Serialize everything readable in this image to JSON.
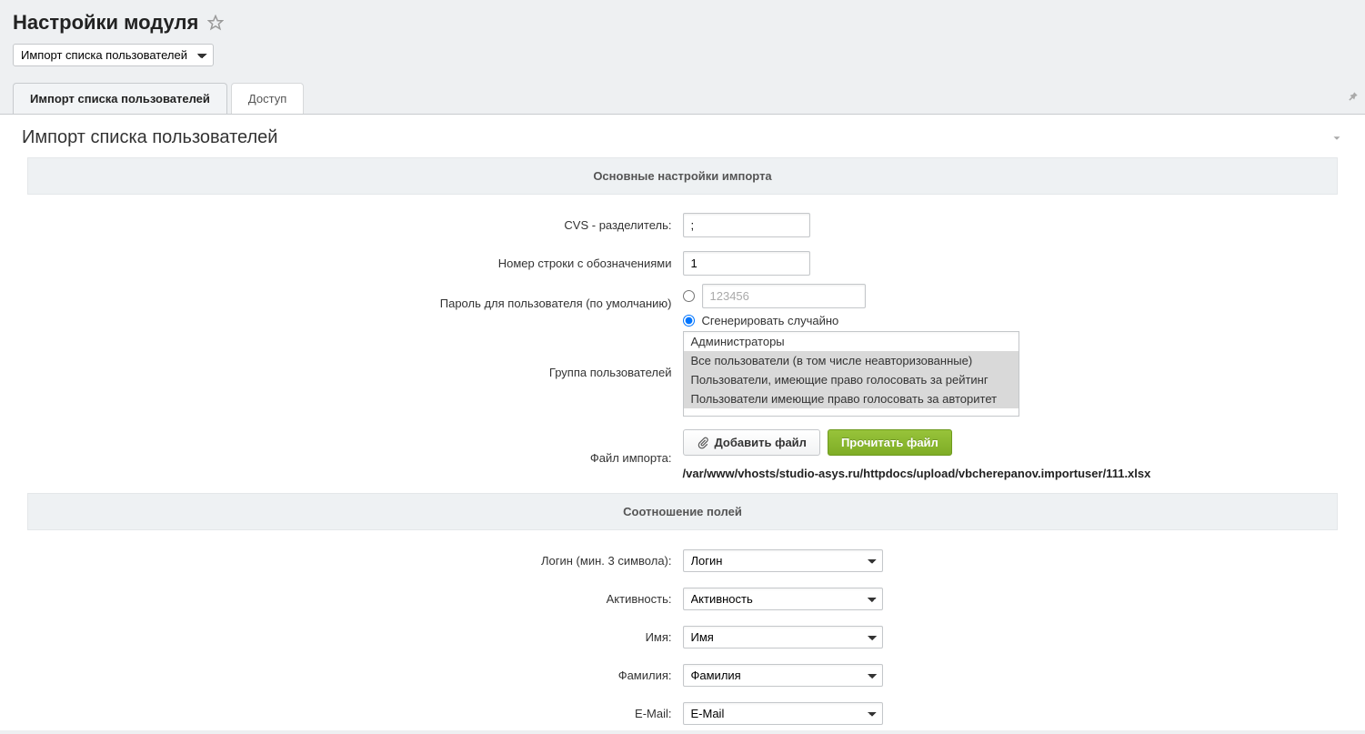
{
  "header": {
    "title": "Настройки модуля",
    "select_value": "Импорт списка пользователей"
  },
  "tabs": [
    {
      "label": "Импорт списка пользователей",
      "active": true
    },
    {
      "label": "Доступ",
      "active": false
    }
  ],
  "panel": {
    "title": "Импорт списка пользователей"
  },
  "sections": {
    "main": "Основные настройки импорта",
    "mapping": "Соотношение полей"
  },
  "form": {
    "cvs_label": "CVS - разделитель:",
    "cvs_value": ";",
    "row_label": "Номер строки с обозначениями",
    "row_value": "1",
    "pwd_label": "Пароль для пользователя (по умолчанию)",
    "pwd_placeholder": "123456",
    "pwd_radio_generate": "Сгенерировать случайно",
    "group_label": "Группа пользователей",
    "group_options": [
      {
        "text": "Администраторы",
        "selected": false
      },
      {
        "text": "Все пользователи (в том числе неавторизованные)",
        "selected": true
      },
      {
        "text": "Пользователи, имеющие право голосовать за рейтинг",
        "selected": true
      },
      {
        "text": "Пользователи имеющие право голосовать за авторитет",
        "selected": true
      }
    ],
    "file_label": "Файл импорта:",
    "add_file_btn": "Добавить файл",
    "read_file_btn": "Прочитать файл",
    "file_path": "/var/www/vhosts/studio-asys.ru/httpdocs/upload/vbcherepanov.importuser/111.xlsx"
  },
  "mapping": {
    "login_label": "Логин (мин. 3 символа):",
    "login_value": "Логин",
    "active_label": "Активность:",
    "active_value": "Активность",
    "name_label": "Имя:",
    "name_value": "Имя",
    "surname_label": "Фамилия:",
    "surname_value": "Фамилия",
    "email_label": "E-Mail:",
    "email_value": "E-Mail"
  }
}
